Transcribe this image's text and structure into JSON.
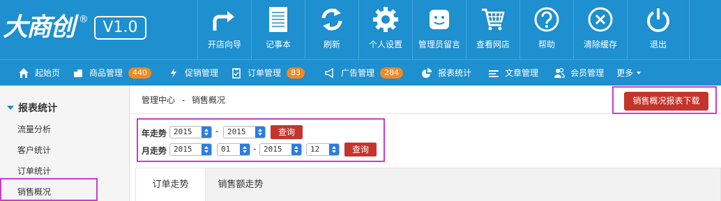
{
  "logo": {
    "text": "大商创",
    "reg": "®",
    "version": "V1.0"
  },
  "toolbar": [
    {
      "label": "开店向导",
      "icon": "arrow-turn-icon"
    },
    {
      "label": "记事本",
      "icon": "notepad-icon"
    },
    {
      "label": "刷新",
      "icon": "refresh-icon"
    },
    {
      "label": "个人设置",
      "icon": "gear-icon"
    },
    {
      "label": "管理员留言",
      "icon": "message-icon"
    },
    {
      "label": "查看网店",
      "icon": "cart-icon"
    },
    {
      "label": "帮助",
      "icon": "help-icon"
    },
    {
      "label": "清除缓存",
      "icon": "close-circle-icon"
    },
    {
      "label": "退出",
      "icon": "power-icon"
    }
  ],
  "nav": [
    {
      "label": "起始页",
      "icon": "home-icon"
    },
    {
      "label": "商品管理",
      "icon": "box-icon",
      "badge": "440"
    },
    {
      "label": "促销管理",
      "icon": "lightning-icon"
    },
    {
      "label": "订单管理",
      "icon": "clipboard-icon",
      "badge": "83"
    },
    {
      "label": "广告管理",
      "icon": "megaphone-icon",
      "badge": "284"
    },
    {
      "label": "报表统计",
      "icon": "pie-chart-icon"
    },
    {
      "label": "文章管理",
      "icon": "list-icon"
    },
    {
      "label": "会员管理",
      "icon": "users-icon"
    },
    {
      "label": "更多",
      "icon": ""
    }
  ],
  "sidebar": {
    "heading": "报表统计",
    "items": [
      "流量分析",
      "客户统计",
      "订单统计",
      "销售概况"
    ]
  },
  "breadcrumb": {
    "root": "管理中心",
    "sep": "-",
    "current": "销售概况"
  },
  "download_button": "销售概况报表下载",
  "filters": {
    "year_label": "年走势",
    "month_label": "月走势",
    "year_from": "2015",
    "year_to": "2015",
    "month_from_year": "2015",
    "month_from_month": "01",
    "month_to_year": "2015",
    "month_to_month": "12",
    "dash": "-",
    "query": "查询"
  },
  "tabs": [
    "订单走势",
    "销售额走势"
  ],
  "colors": {
    "primary": "#1e8fcf",
    "danger": "#c5332b",
    "badge": "#f08a24",
    "highlight": "#c63cd0"
  }
}
